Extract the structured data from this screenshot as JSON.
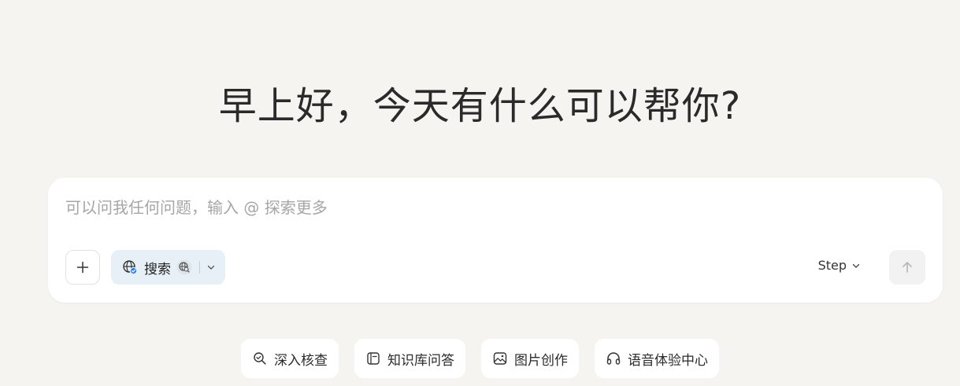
{
  "greeting": "早上好，今天有什么可以帮你?",
  "composer": {
    "placeholder": "可以问我任何问题，输入 @ 探索更多",
    "search_label": "搜索",
    "model_label": "Step"
  },
  "chips": [
    {
      "label": "深入核查",
      "icon": "search-check-icon"
    },
    {
      "label": "知识库问答",
      "icon": "knowledge-base-icon"
    },
    {
      "label": "图片创作",
      "icon": "image-icon"
    },
    {
      "label": "语音体验中心",
      "icon": "headphones-icon"
    }
  ],
  "colors": {
    "background": "#f5f4f1",
    "search_active_bg": "#e8f0f7",
    "accent_blue": "#2f7be8"
  }
}
